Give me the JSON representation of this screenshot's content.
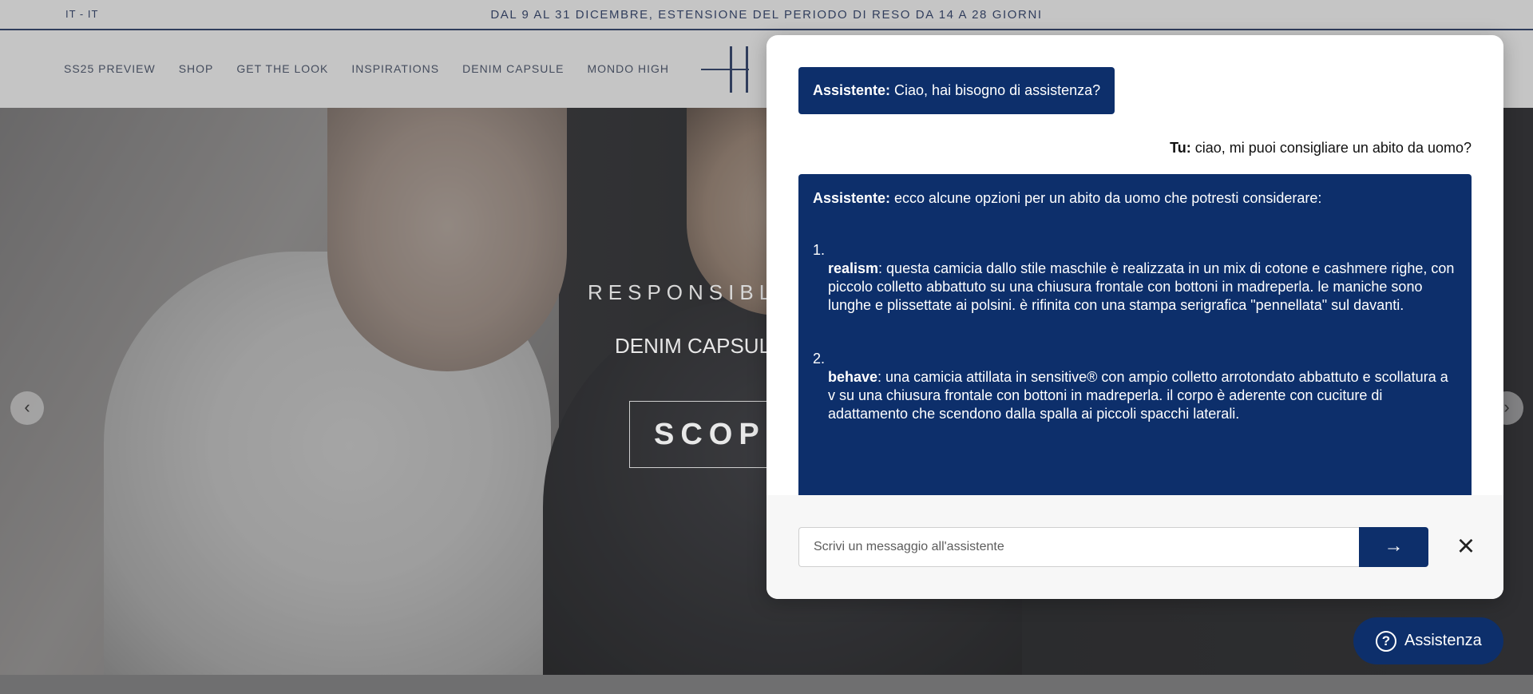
{
  "topbar": {
    "locale": "IT - IT",
    "announcement": "DAL 9 AL 31 DICEMBRE, ESTENSIONE DEL PERIODO DI RESO DA 14 A 28 GIORNI"
  },
  "nav": {
    "items": [
      {
        "label": "SS25 PREVIEW"
      },
      {
        "label": "SHOP"
      },
      {
        "label": "GET THE LOOK"
      },
      {
        "label": "INSPIRATIONS"
      },
      {
        "label": "DENIM CAPSULE"
      },
      {
        "label": "MONDO HIGH"
      }
    ]
  },
  "hero": {
    "kicker": "RESPONSIBLY",
    "subtitle": "DENIM CAPSUL",
    "cta": "SCOPR",
    "prev_icon": "chevron-left-icon",
    "next_icon": "chevron-right-icon"
  },
  "chat": {
    "messages": {
      "greeting_role": "Assistente:",
      "greeting_text": " Ciao, hai bisogno di assistenza?",
      "user_role": "Tu:",
      "user_text": " ciao, mi puoi consigliare un abito da uomo?",
      "reply_role": "Assistente:",
      "reply_intro": " ecco alcune opzioni per un abito da uomo che potresti considerare:",
      "options": [
        {
          "number": "1.",
          "name": "realism",
          "text": ": questa camicia dallo stile maschile è realizzata in un mix di cotone e cashmere righe, con piccolo colletto abbattuto su una chiusura frontale con bottoni in madreperla. le maniche sono lunghe e plissettate ai polsini. è rifinita con una stampa serigrafica \"pennellata\" sul davanti."
        },
        {
          "number": "2.",
          "name": "behave",
          "text": ": una camicia attillata in sensitive® con ampio colletto arrotondato abbattuto e scollatura a v su una chiusura frontale con bottoni in madreperla. il corpo è aderente con cuciture di adattamento che scendono dalla spalla ai piccoli spacchi laterali."
        }
      ]
    },
    "input_placeholder": "Scrivi un messaggio all'assistente",
    "send_icon": "arrow-right-icon",
    "close_icon": "close-icon",
    "accent_color": "#0d2f6b"
  },
  "help_button": {
    "label": "Assistenza",
    "icon": "question-circle-icon"
  }
}
